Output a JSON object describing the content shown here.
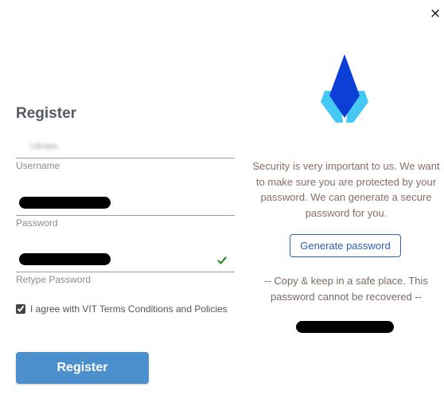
{
  "dialog": {
    "close_glyph": "×",
    "title": "Register"
  },
  "form": {
    "username": {
      "value": "Ultraex",
      "label": "Username"
    },
    "password": {
      "label": "Password"
    },
    "retype_password": {
      "label": "Retype Password",
      "match_icon": "check-icon"
    },
    "agree": {
      "checked": true,
      "label": "I agree with VIT Terms Conditions and Policies"
    },
    "register_label": "Register"
  },
  "info": {
    "security_text": "Security is very important to us. We want to make sure you are protected by your password. We can generate a secure password for you.",
    "generate_label": "Generate password",
    "note_text": "-- Copy & keep in a safe place. This password cannot be recovered --"
  },
  "colors": {
    "accent": "#4b90cd",
    "logo_dark": "#0b3fd6",
    "logo_light": "#46c8f5",
    "check": "#2e8b2e"
  }
}
